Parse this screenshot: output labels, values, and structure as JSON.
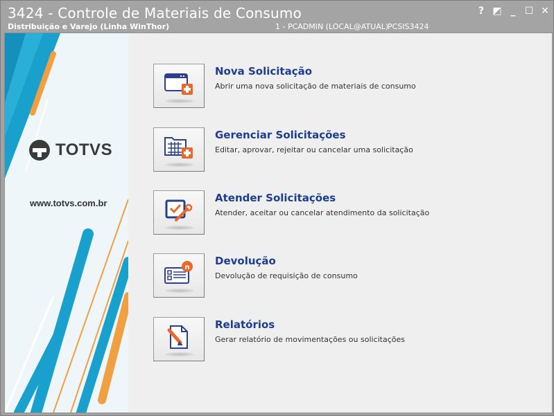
{
  "window": {
    "title": "3424 - Controle de Materiais de Consumo",
    "subtitle": "Distribuição e Varejo (Linha WinThor)",
    "status_user": "1 - PCADMIN (LOCAL@ATUAL)",
    "status_program": "PCSIS3424",
    "controls": {
      "help": "?",
      "restore": "◩",
      "minimize": "_",
      "maximize": "☐",
      "close": "✕"
    }
  },
  "banner": {
    "brand": "TOTVS",
    "website": "www.totvs.com.br"
  },
  "menu": [
    {
      "title": "Nova Solicitação",
      "description": "Abrir uma nova solicitação de materiais de consumo",
      "icon": "new-request-icon"
    },
    {
      "title": "Gerenciar Solicitações",
      "description": "Editar, aprovar, rejeitar ou cancelar uma solicitação",
      "icon": "manage-requests-icon"
    },
    {
      "title": "Atender Solicitações",
      "description": "Atender, aceitar ou cancelar atendimento da solicitação",
      "icon": "fulfill-requests-icon"
    },
    {
      "title": "Devolução",
      "description": "Devolução de requisição de consumo",
      "icon": "return-icon"
    },
    {
      "title": "Relatórios",
      "description": "Gerar relatório de movimentações ou solicitações",
      "icon": "reports-icon"
    }
  ],
  "colors": {
    "accent_blue": "#1d3d8f",
    "brand_cyan": "#1aa0cc",
    "brand_orange": "#f0a040",
    "titlebar": "#a4a4a4"
  }
}
